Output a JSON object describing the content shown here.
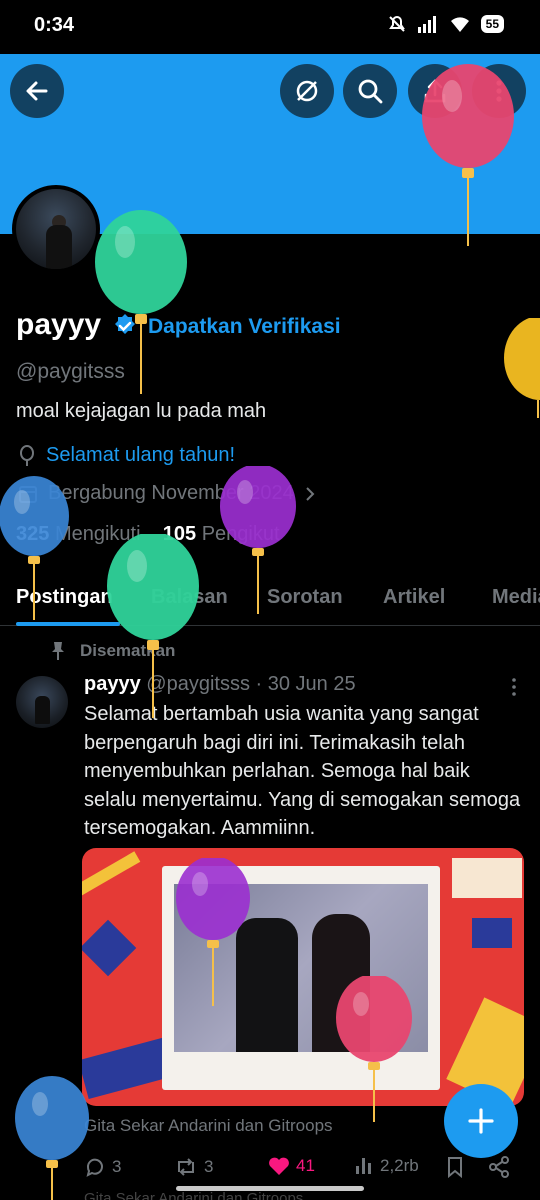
{
  "status_bar": {
    "time": "0:34",
    "battery": "55"
  },
  "profile": {
    "name": "payyy",
    "verify_cta": "Dapatkan Verifikasi",
    "handle": "@paygitsss",
    "bio": "moal kejajagan lu pada mah",
    "birthday_link": "Selamat ulang tahun!",
    "joined": "Bergabung November 2024",
    "following_count": "325",
    "following_label": "Mengikuti",
    "followers_count": "105",
    "followers_label": "Pengikut"
  },
  "tabs": [
    "Postingan",
    "Balasan",
    "Sorotan",
    "Artikel",
    "Media"
  ],
  "pinned_label": "Disematkan",
  "post": {
    "author_name": "payyy",
    "author_handle": "@paygitsss",
    "date": "· 30 Jun 25",
    "text": "Selamat bertambah usia wanita yang sangat berpengaruh bagi diri ini. Terimakasih telah menyembuhkan perlahan. Semoga hal baik selalu menyertaimu. Yang di semogakan semoga tersemogakan. Aammiinn.",
    "media_caption": "Gita Sekar Andarini dan Gitroops",
    "replies": "3",
    "reposts": "3",
    "likes": "41",
    "views": "2,2rb"
  },
  "next_caption": "Gita Sekar Andarini dan Gitroops",
  "icons": {
    "back": "arrow-left-icon",
    "grok": "slash-circle-icon",
    "search": "search-icon",
    "share_profile": "share-icon",
    "more": "more-vertical-icon",
    "compose": "plus-icon"
  },
  "colors": {
    "accent": "#1d9bf0",
    "like": "#f91880",
    "muted": "#71767b",
    "background": "#000000"
  }
}
